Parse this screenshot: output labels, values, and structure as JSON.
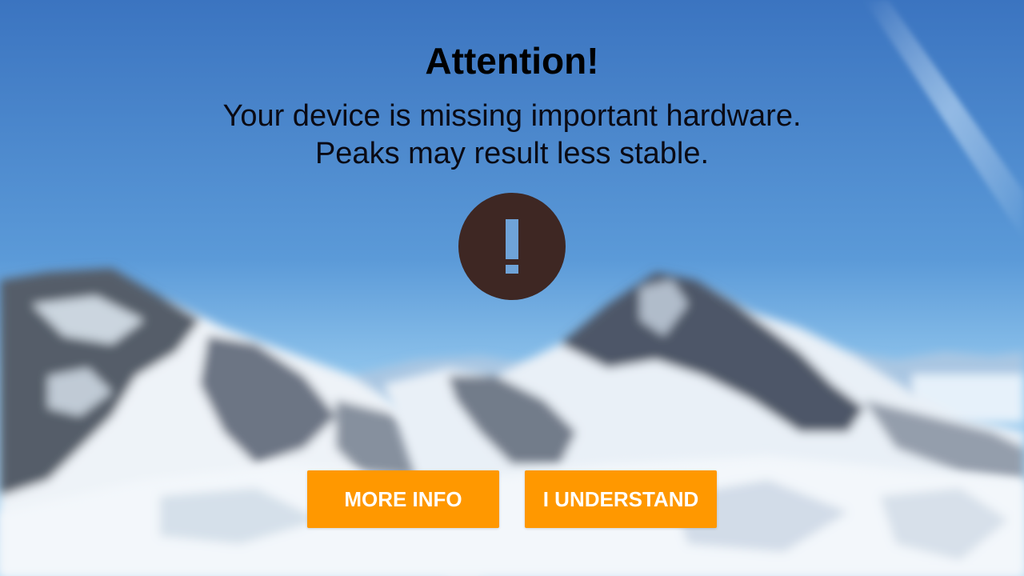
{
  "dialog": {
    "title": "Attention!",
    "message_line1": "Your device is missing important hardware.",
    "message_line2": "Peaks may result less stable.",
    "icon": "exclamation-icon"
  },
  "buttons": {
    "more_info_label": "MORE INFO",
    "understand_label": "I UNDERSTAND"
  },
  "colors": {
    "button_bg": "#FF9800",
    "icon_bg": "#3E2723",
    "icon_glyph": "#6FA3D8",
    "sky_top": "#3d78c2",
    "sky_bottom": "#8ec2ea"
  }
}
